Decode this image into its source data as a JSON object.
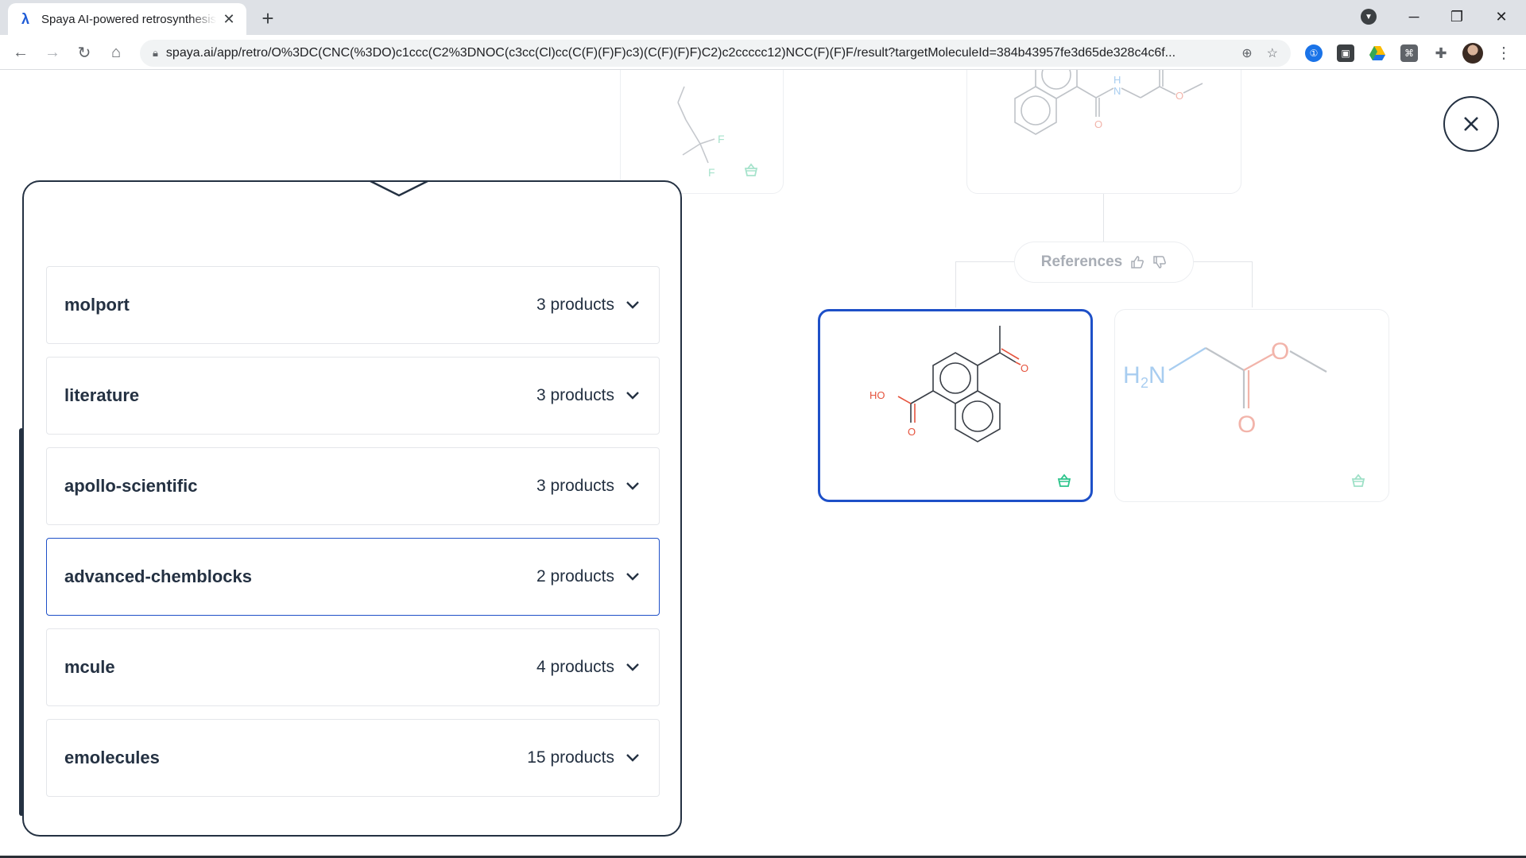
{
  "browser": {
    "tab_title": "Spaya AI-powered retrosynthesis",
    "tab_close": "✕",
    "new_tab": "+",
    "url": "spaya.ai/app/retro/O%3DC(CNC(%3DO)c1ccc(C2%3DNOC(c3cc(Cl)cc(C(F)(F)F)c3)(C(F)(F)F)C2)c2ccccc12)NCC(F)(F)F/result?targetMoleculeId=384b43957fe3d65de328c4c6f...",
    "win_minimize": "─",
    "win_restore": "❐",
    "win_close": "✕"
  },
  "tree": {
    "references_label": "References",
    "reactant_labels": {
      "ho": "HO",
      "o": "O",
      "h2n_h": "H",
      "h2n_n": "N",
      "h2n_sub": "2",
      "ester_o": "O",
      "carbonyl_o": "O",
      "f": "F",
      "nh_h": "H",
      "nh_n": "N"
    }
  },
  "suppliers": [
    {
      "name": "molport",
      "count": "3 products"
    },
    {
      "name": "literature",
      "count": "3 products"
    },
    {
      "name": "apollo-scientific",
      "count": "3 products"
    },
    {
      "name": "advanced-chemblocks",
      "count": "2 products"
    },
    {
      "name": "mcule",
      "count": "4 products"
    },
    {
      "name": "emolecules",
      "count": "15 products"
    }
  ],
  "colors": {
    "accent": "#1e50c8",
    "basket": "#2cc48b",
    "dark": "#243142",
    "oxygen": "#e5533d",
    "nitrogen": "#7fb4e8"
  }
}
